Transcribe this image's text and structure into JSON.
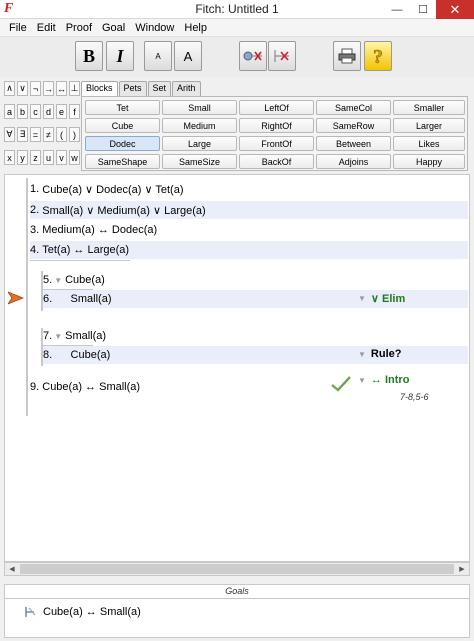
{
  "window": {
    "title": "Fitch: Untitled 1",
    "minimize": "—",
    "maximize": "☐",
    "close": "✕"
  },
  "menu": [
    "File",
    "Edit",
    "Proof",
    "Goal",
    "Window",
    "Help"
  ],
  "toolbar": {
    "bold": "B",
    "italic": "I",
    "font_smaller": "A",
    "font_larger": "A"
  },
  "symbols": [
    "∧",
    "∨",
    "¬",
    "→",
    "↔",
    "⊥",
    "a",
    "b",
    "c",
    "d",
    "e",
    "f",
    "∀",
    "∃",
    "=",
    "≠",
    "(",
    ")",
    "x",
    "y",
    "z",
    "u",
    "v",
    "w"
  ],
  "tabs": [
    {
      "label": "Blocks",
      "active": true
    },
    {
      "label": "Pets",
      "active": false
    },
    {
      "label": "Set",
      "active": false
    },
    {
      "label": "Arith",
      "active": false
    }
  ],
  "predicates": [
    [
      "Tet",
      "Small",
      "LeftOf",
      "SameCol",
      "Smaller"
    ],
    [
      "Cube",
      "Medium",
      "RightOf",
      "SameRow",
      "Larger"
    ],
    [
      "Dodec",
      "Large",
      "FrontOf",
      "Between",
      "Likes"
    ],
    [
      "SameShape",
      "SameSize",
      "BackOf",
      "Adjoins",
      "Happy"
    ]
  ],
  "selected_predicate": "Dodec",
  "proof": {
    "premises": [
      {
        "num": "1.",
        "text": "Cube(a) ∨ Dodec(a) ∨ Tet(a)"
      },
      {
        "num": "2.",
        "text": "Small(a) ∨ Medium(a) ∨ Large(a)"
      },
      {
        "num": "3.",
        "text": "Medium(a) ↔ Dodec(a)"
      },
      {
        "num": "4.",
        "text": "Tet(a) ↔ Large(a)"
      }
    ],
    "sub1": [
      {
        "num": "5.",
        "text": "Cube(a)"
      },
      {
        "num": "6.",
        "text": "Small(a)",
        "rule": "∨ Elim",
        "rule_status": "green"
      }
    ],
    "sub2": [
      {
        "num": "7.",
        "text": "Small(a)"
      },
      {
        "num": "8.",
        "text": "Cube(a)",
        "rule": "Rule?",
        "rule_status": "pending"
      }
    ],
    "conclusion": {
      "num": "9.",
      "text": "Cube(a) ↔ Small(a)",
      "rule": "↔ Intro",
      "support": "7-8,5-6"
    }
  },
  "goals": {
    "header": "Goals",
    "items": [
      "Cube(a) ↔ Small(a)"
    ]
  },
  "colors": {
    "accent_green": "#1f7a1f",
    "highlight": "#eaeefa",
    "close_red": "#c7302b",
    "marker_orange": "#e3702a"
  }
}
